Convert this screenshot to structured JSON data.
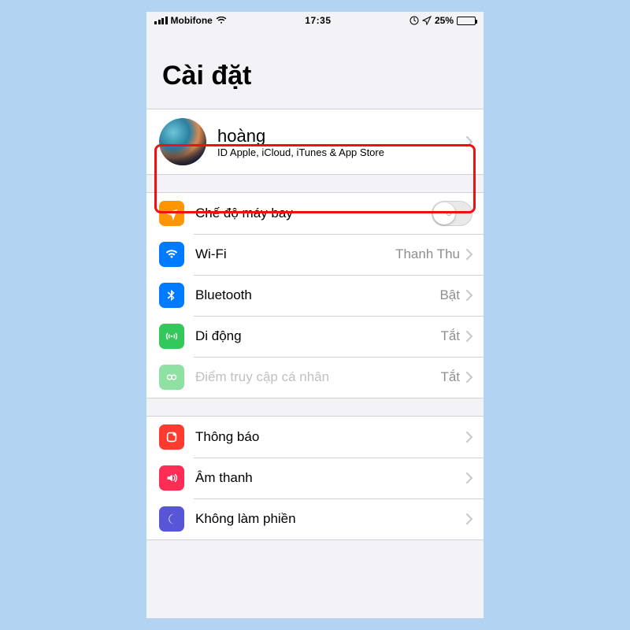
{
  "status": {
    "carrier": "Mobifone",
    "time": "17:35",
    "battery_pct": "25%"
  },
  "page": {
    "title": "Cài đặt"
  },
  "profile": {
    "name": "hoàng",
    "subtitle": "ID Apple, iCloud, iTunes & App Store"
  },
  "group1": {
    "airplane": {
      "label": "Chế độ máy bay"
    },
    "wifi": {
      "label": "Wi-Fi",
      "value": "Thanh Thu"
    },
    "bluetooth": {
      "label": "Bluetooth",
      "value": "Bật"
    },
    "cellular": {
      "label": "Di động",
      "value": "Tắt"
    },
    "hotspot": {
      "label": "Điểm truy cập cá nhân",
      "value": "Tắt"
    }
  },
  "group2": {
    "notifications": {
      "label": "Thông báo"
    },
    "sounds": {
      "label": "Âm thanh"
    },
    "dnd": {
      "label": "Không làm phiền"
    }
  },
  "colors": {
    "airplane": "#ff9500",
    "wifi": "#007aff",
    "bluetooth": "#007aff",
    "cellular": "#34c759",
    "hotspot": "#34c759",
    "notifications": "#ff3b30",
    "sounds": "#ff2d55",
    "dnd": "#5856d6"
  }
}
